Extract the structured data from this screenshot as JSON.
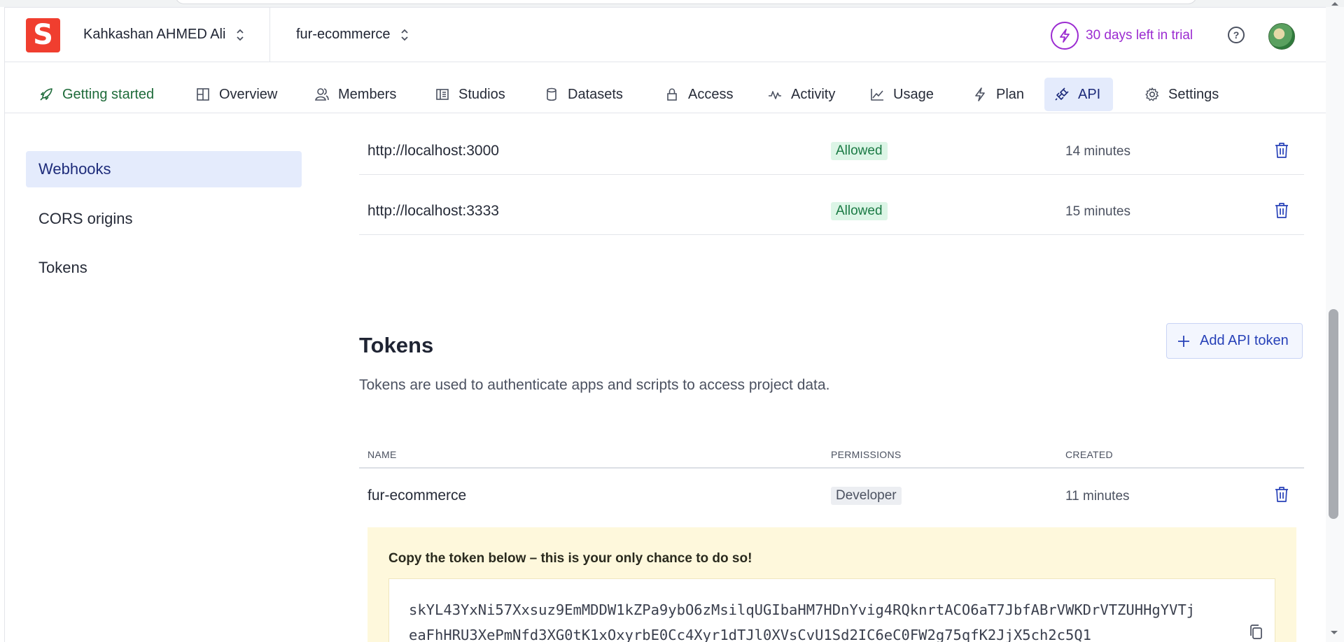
{
  "topbar": {
    "logo_letter": "S",
    "org_name": "Kahkashan AHMED Ali",
    "project_name": "fur-ecommerce",
    "trial_text": "30 days left in trial",
    "help_glyph": "?"
  },
  "nav": {
    "tabs": [
      {
        "label": "Getting started",
        "icon": "rocket-icon"
      },
      {
        "label": "Overview",
        "icon": "grid-icon"
      },
      {
        "label": "Members",
        "icon": "users-icon"
      },
      {
        "label": "Studios",
        "icon": "studio-icon"
      },
      {
        "label": "Datasets",
        "icon": "database-icon"
      },
      {
        "label": "Access",
        "icon": "lock-icon"
      },
      {
        "label": "Activity",
        "icon": "activity-icon"
      },
      {
        "label": "Usage",
        "icon": "chart-icon"
      },
      {
        "label": "Plan",
        "icon": "bolt-icon"
      },
      {
        "label": "API",
        "icon": "plug-icon"
      },
      {
        "label": "Settings",
        "icon": "gear-icon"
      }
    ],
    "active_tab": "API"
  },
  "sidebar": {
    "items": [
      {
        "label": "Webhooks",
        "active": true
      },
      {
        "label": "CORS origins",
        "active": false
      },
      {
        "label": "Tokens",
        "active": false
      }
    ]
  },
  "cors": {
    "rows": [
      {
        "origin": "http://localhost:3000",
        "status": "Allowed",
        "created": "14 minutes"
      },
      {
        "origin": "http://localhost:3333",
        "status": "Allowed",
        "created": "15 minutes"
      }
    ]
  },
  "tokens": {
    "title": "Tokens",
    "add_button": "Add API token",
    "description": "Tokens are used to authenticate apps and scripts to access project data.",
    "headers": {
      "name": "NAME",
      "permissions": "PERMISSIONS",
      "created": "CREATED"
    },
    "rows": [
      {
        "name": "fur-ecommerce",
        "permission": "Developer",
        "created": "11 minutes"
      }
    ],
    "warning": "Copy the token below – this is your only chance to do so!",
    "token_value": "skYL43YxNi57Xxsuz9EmMDDW1kZPa9ybO6zMsilqUGIbaHM7HDnYvig4RQknrtACO6aT7JbfABrVWKDrVTZUHHgYVTjeaFhHRU3XePmNfd3XG0tK1xOxyrbE0Cc4Xyr1dTJl0XVsCvU1Sd2IC6eC0FW2g75qfK2JjX5ch2c5Q1"
  },
  "colors": {
    "brand": "#f03e2f",
    "trial": "#9b2bd1",
    "active_bg": "#e4ebfc",
    "allowed_bg": "#dcf5e6",
    "warning_bg": "#fef8dc"
  }
}
